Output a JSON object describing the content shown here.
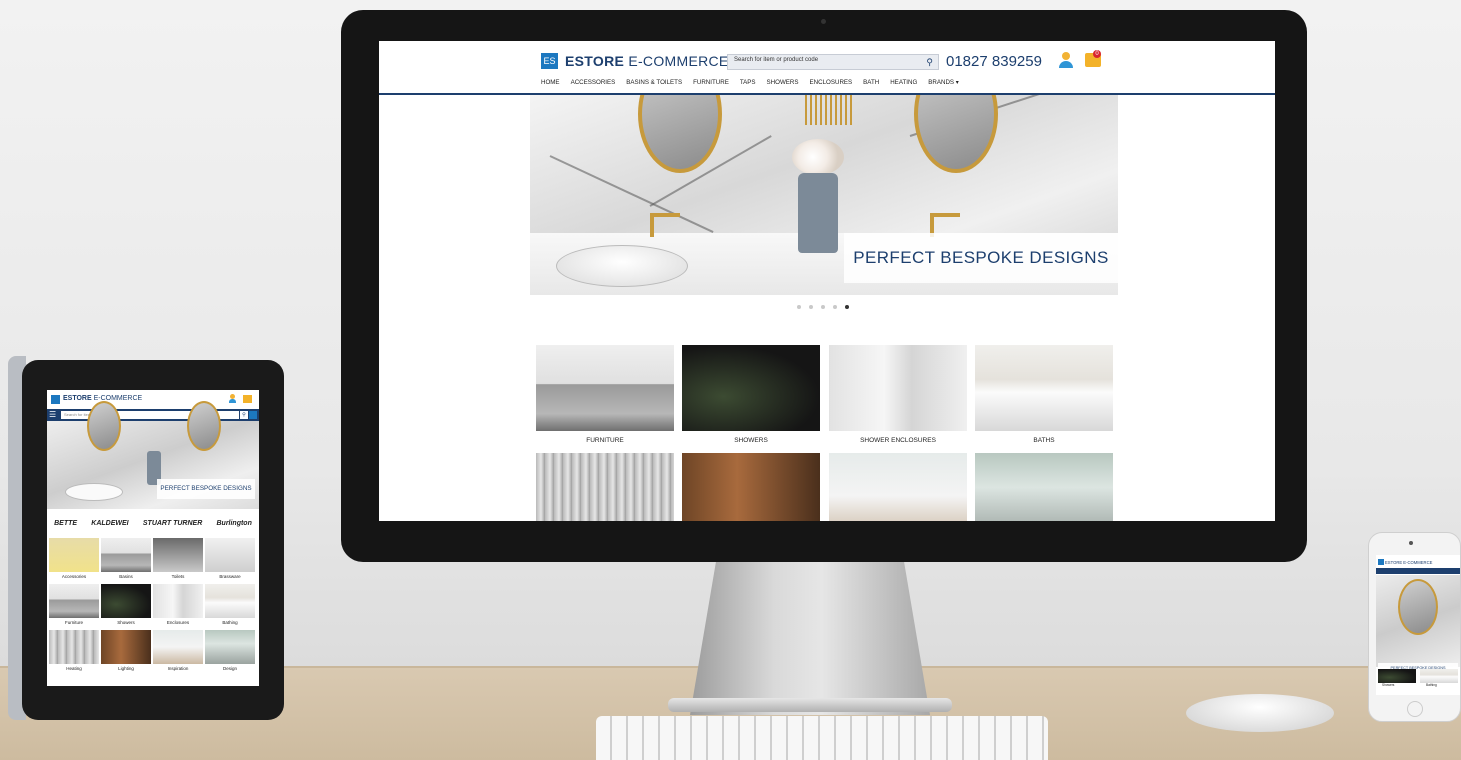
{
  "desktop": {
    "logo_badge": "ES",
    "logo_bold": "ESTORE",
    "logo_rest": " E-COMMERCE",
    "search_placeholder": "Search for item or product code",
    "phone": "01827 839259",
    "cart_count": "0",
    "nav": [
      "HOME",
      "ACCESSORIES",
      "BASINS & TOILETS",
      "FURNITURE",
      "TAPS",
      "SHOWERS",
      "ENCLOSURES",
      "BATH",
      "HEATING",
      "BRANDS ▾"
    ],
    "hero_caption": "PERFECT BESPOKE DESIGNS",
    "categories": [
      "FURNITURE",
      "SHOWERS",
      "SHOWER ENCLOSURES",
      "BATHS"
    ]
  },
  "tablet": {
    "logo_bold": "ESTORE",
    "logo_rest": " E-COMMERCE",
    "search_placeholder": "Search for item",
    "hero_caption": "PERFECT BESPOKE DESIGNS",
    "brands": [
      "BETTE",
      "KALDEWEI",
      "STUART TURNER",
      "Burlington"
    ],
    "tiles": [
      "Accessories",
      "Basins",
      "Toilets",
      "Brassware",
      "Furniture",
      "Showers",
      "Enclosures",
      "Bathing",
      "Heating",
      "Lighting",
      "Inspiration",
      "Design"
    ]
  },
  "phone": {
    "logo": "ESTORE E-COMMERCE",
    "hero_caption": "PERFECT BESPOKE DESIGNS",
    "tile_1": "Showers",
    "tile_2": "Bathing"
  },
  "colors": {
    "brand_navy": "#1d3f6e",
    "brand_blue": "#1c78c0",
    "cart_yellow": "#f3b229",
    "badge_red": "#d9252e"
  }
}
